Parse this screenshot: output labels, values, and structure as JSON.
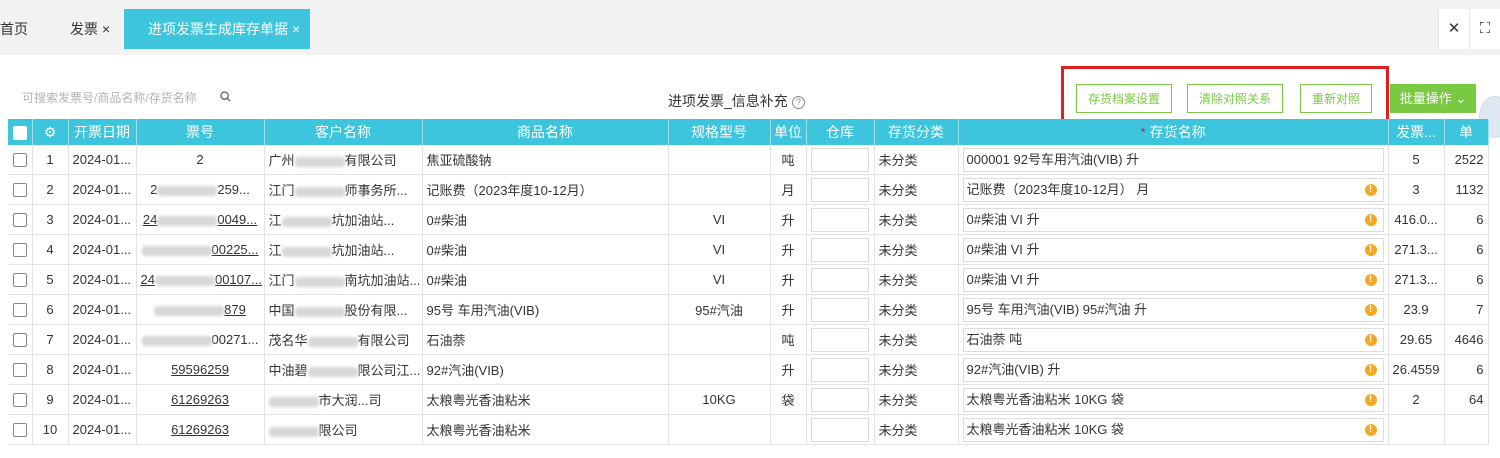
{
  "tabs": [
    {
      "label": "首页"
    },
    {
      "label": "发票",
      "close": "×"
    },
    {
      "label": "进项发票生成库存单据",
      "close": "×"
    }
  ],
  "tab_icons": {
    "close": "✕",
    "fullscreen": "⛶"
  },
  "toolbar": {
    "search_placeholder": "可搜索发票号/商品名称/存货名称",
    "title": "进项发票_信息补充",
    "help": "?",
    "btn_settings": "存货档案设置",
    "btn_clear": "清除对照关系",
    "btn_rematch": "重新对照",
    "btn_batch": "批量操作"
  },
  "colors": {
    "header": "#3dc5dd",
    "accent": "#7ac943",
    "highlight": "#e02020",
    "warning": "#f5a623"
  },
  "table": {
    "headers": {
      "date": "开票日期",
      "invoice_no": "票号",
      "customer": "客户名称",
      "product": "商品名称",
      "spec": "规格型号",
      "unit": "单位",
      "warehouse": "仓库",
      "category": "存货分类",
      "inventory": "存货名称",
      "qty": "发票...",
      "price": "单"
    },
    "rows": [
      {
        "no": "1",
        "date": "2024-01...",
        "invoice_pre": "2",
        "invoice_suf": "",
        "invoice_link": false,
        "customer_pre": "广州",
        "customer_suf": "有限公司",
        "product": "焦亚硫酸钠",
        "spec": "",
        "unit": "吨",
        "category": "未分类",
        "inventory": "000001 92号车用汽油(VIB) 升",
        "warn": false,
        "qty": "5",
        "price": "2522"
      },
      {
        "no": "2",
        "date": "2024-01...",
        "invoice_pre": "2",
        "invoice_suf": "259...",
        "invoice_link": false,
        "customer_pre": "江门",
        "customer_suf": "师事务所...",
        "product": "记账费（2023年度10-12月）",
        "spec": "",
        "unit": "月",
        "category": "未分类",
        "inventory": "记账费（2023年度10-12月） 月",
        "warn": true,
        "qty": "3",
        "price": "1132"
      },
      {
        "no": "3",
        "date": "2024-01...",
        "invoice_pre": "24",
        "invoice_suf": "0049...",
        "invoice_link": true,
        "customer_pre": "江",
        "customer_suf": "坑加油站...",
        "product": "0#柴油",
        "spec": "VI",
        "unit": "升",
        "category": "未分类",
        "inventory": "0#柴油 VI 升",
        "warn": true,
        "qty": "416.0...",
        "price": "6"
      },
      {
        "no": "4",
        "date": "2024-01...",
        "invoice_pre": "",
        "invoice_suf": "00225...",
        "invoice_link": true,
        "customer_pre": "江",
        "customer_suf": "坑加油站...",
        "product": "0#柴油",
        "spec": "VI",
        "unit": "升",
        "category": "未分类",
        "inventory": "0#柴油 VI 升",
        "warn": true,
        "qty": "271.3...",
        "price": "6"
      },
      {
        "no": "5",
        "date": "2024-01...",
        "invoice_pre": "24",
        "invoice_suf": "00107...",
        "invoice_link": true,
        "customer_pre": "江门",
        "customer_suf": "南坑加油站...",
        "product": "0#柴油",
        "spec": "VI",
        "unit": "升",
        "category": "未分类",
        "inventory": "0#柴油 VI 升",
        "warn": true,
        "qty": "271.3...",
        "price": "6"
      },
      {
        "no": "6",
        "date": "2024-01...",
        "invoice_pre": "",
        "invoice_suf": "879",
        "invoice_link": true,
        "customer_pre": "中国",
        "customer_suf": "股份有限...",
        "product": "95号 车用汽油(VIB)",
        "spec": "95#汽油",
        "unit": "升",
        "category": "未分类",
        "inventory": "95号 车用汽油(VIB) 95#汽油 升",
        "warn": true,
        "qty": "23.9",
        "price": "7"
      },
      {
        "no": "7",
        "date": "2024-01...",
        "invoice_pre": "",
        "invoice_suf": "00271...",
        "invoice_link": false,
        "customer_pre": "茂名华",
        "customer_suf": "有限公司",
        "product": "石油萘",
        "spec": "",
        "unit": "吨",
        "category": "未分类",
        "inventory": "石油萘 吨",
        "warn": true,
        "qty": "29.65",
        "price": "4646"
      },
      {
        "no": "8",
        "date": "2024-01...",
        "invoice_pre": "59596259",
        "invoice_suf": "",
        "invoice_link": true,
        "customer_pre": "中油碧",
        "customer_suf": "限公司江...",
        "product": "92#汽油(VIB)",
        "spec": "",
        "unit": "升",
        "category": "未分类",
        "inventory": "92#汽油(VIB) 升",
        "warn": true,
        "qty": "26.4559",
        "price": "6"
      },
      {
        "no": "9",
        "date": "2024-01...",
        "invoice_pre": "61269263",
        "invoice_suf": "",
        "invoice_link": true,
        "customer_pre": "",
        "customer_suf": "市大润...司",
        "product": "太粮粤光香油粘米",
        "spec": "10KG",
        "unit": "袋",
        "category": "未分类",
        "inventory": "太粮粤光香油粘米 10KG 袋",
        "warn": true,
        "qty": "2",
        "price": "64"
      },
      {
        "no": "10",
        "date": "2024-01...",
        "invoice_pre": "61269263",
        "invoice_suf": "",
        "invoice_link": true,
        "customer_pre": "",
        "customer_suf": "限公司",
        "product": "太粮粤光香油粘米",
        "spec": "",
        "unit": "",
        "category": "未分类",
        "inventory": "太粮粤光香油粘米 10KG 袋",
        "warn": true,
        "qty": "",
        "price": ""
      }
    ]
  }
}
